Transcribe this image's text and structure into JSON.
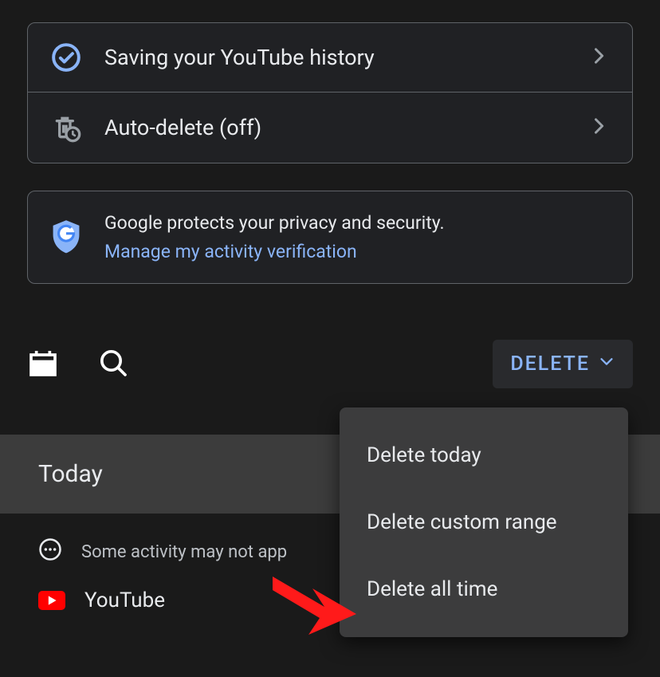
{
  "settings": {
    "history_label": "Saving your YouTube history",
    "autodelete_label": "Auto-delete (off)"
  },
  "privacy": {
    "text": "Google protects your privacy and security.",
    "link_text": "Manage my activity verification"
  },
  "toolbar": {
    "delete_label": "DELETE"
  },
  "section": {
    "today_label": "Today"
  },
  "notice": {
    "partial_text": "Some activity may not app"
  },
  "apps": {
    "youtube_label": "YouTube"
  },
  "menu": {
    "delete_today": "Delete today",
    "delete_custom": "Delete custom range",
    "delete_all": "Delete all time"
  }
}
